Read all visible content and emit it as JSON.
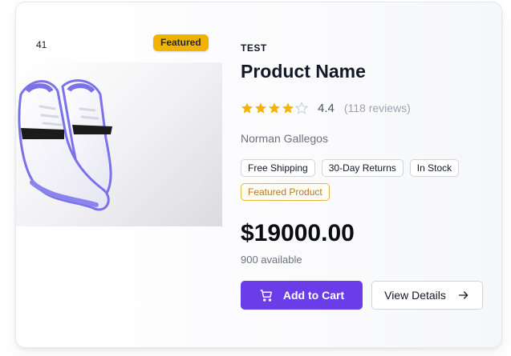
{
  "media": {
    "count": "41",
    "badge": "Featured"
  },
  "product": {
    "brand": "TEST",
    "title": "Product Name",
    "rating": "4.4",
    "reviews": "(118 reviews)",
    "stars_filled": 4.4,
    "seller": "Norman Gallegos",
    "tags": [
      "Free Shipping",
      "30-Day Returns",
      "In Stock"
    ],
    "featured_tag": "Featured Product",
    "price": "$19000.00",
    "availability": "900 available"
  },
  "actions": {
    "add_to_cart": "Add to Cart",
    "view_details": "View Details"
  },
  "colors": {
    "accent": "#6a3de8",
    "star": "#f5b301",
    "badge": "#f0b400"
  }
}
